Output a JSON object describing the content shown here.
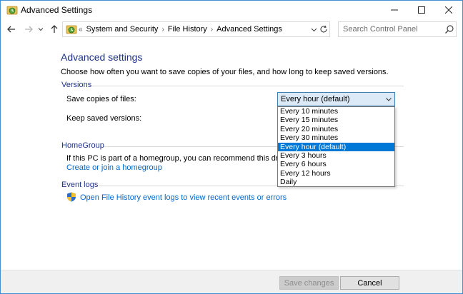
{
  "window": {
    "title": "Advanced Settings",
    "icon": "file-history-icon"
  },
  "address_bar": {
    "prefix": "«",
    "breadcrumbs": [
      "System and Security",
      "File History",
      "Advanced Settings"
    ],
    "search_placeholder": "Search Control Panel"
  },
  "main": {
    "title": "Advanced settings",
    "description": "Choose how often you want to save copies of your files, and how long to keep saved versions.",
    "versions": {
      "heading": "Versions",
      "save_copies_label": "Save copies of files:",
      "keep_versions_label": "Keep saved versions:",
      "selected_value": "Every hour (default)",
      "options": [
        "Every 10 minutes",
        "Every 15 minutes",
        "Every 20 minutes",
        "Every 30 minutes",
        "Every hour (default)",
        "Every 3 hours",
        "Every 6 hours",
        "Every 12 hours",
        "Daily"
      ],
      "selected_index": 4
    },
    "homegroup": {
      "heading": "HomeGroup",
      "text": "If this PC is part of a homegroup, you can recommend this drive to",
      "link": "Create or join a homegroup"
    },
    "event_logs": {
      "heading": "Event logs",
      "link": "Open File History event logs to view recent events or errors"
    }
  },
  "footer": {
    "save_label": "Save changes",
    "cancel_label": "Cancel"
  },
  "colors": {
    "heading": "#1e3287",
    "link": "#0066cc",
    "selection": "#0078d7"
  }
}
